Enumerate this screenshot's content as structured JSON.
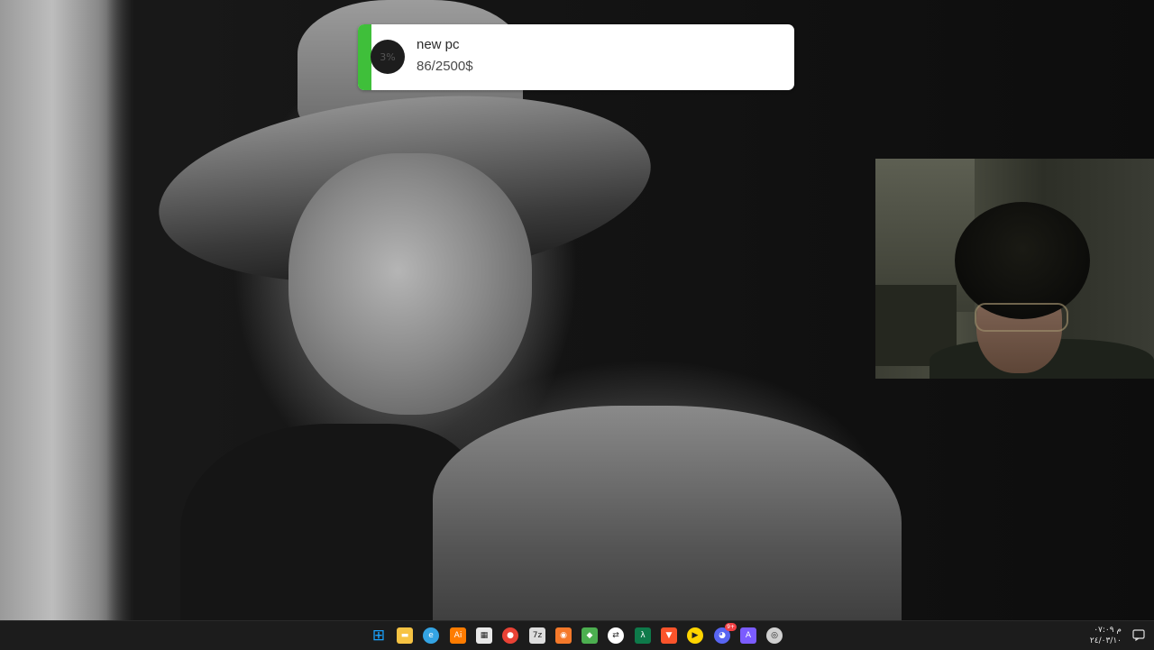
{
  "goal_widget": {
    "percent_label": "3%",
    "title": "new pc",
    "amount": "86/2500$",
    "progress_fraction": 0.03,
    "accent_color": "#3fbf3a"
  },
  "taskbar": {
    "clock_time": "م ٠٧:٠٩",
    "clock_date": "٢٤/٠٣/١٠",
    "discord_badge": "9+",
    "pinned_apps": [
      {
        "name": "windows-start-icon",
        "color": "#1aa3ff"
      },
      {
        "name": "file-explorer-icon",
        "color": "#f6c343"
      },
      {
        "name": "edge-icon",
        "color": "#34a4e4"
      },
      {
        "name": "illustrator-icon",
        "color": "#ff7c00"
      },
      {
        "name": "microsoft-store-icon",
        "color": "#e8e8e8"
      },
      {
        "name": "chrome-icon",
        "color": "#e94235"
      },
      {
        "name": "7zip-icon",
        "color": "#dddddd"
      },
      {
        "name": "blender-icon",
        "color": "#f5792a"
      },
      {
        "name": "layers-app-icon",
        "color": "#4caf50"
      },
      {
        "name": "messaging-app-icon",
        "color": "#ffffff"
      },
      {
        "name": "terminal-lambda-icon",
        "color": "#0e7a4a"
      },
      {
        "name": "brave-icon",
        "color": "#fb542b"
      },
      {
        "name": "media-player-icon",
        "color": "#ffd500"
      },
      {
        "name": "discord-icon",
        "color": "#5865f2"
      },
      {
        "name": "affinity-icon",
        "color": "#7b5cff"
      },
      {
        "name": "obs-icon",
        "color": "#d0d0d0"
      }
    ]
  }
}
